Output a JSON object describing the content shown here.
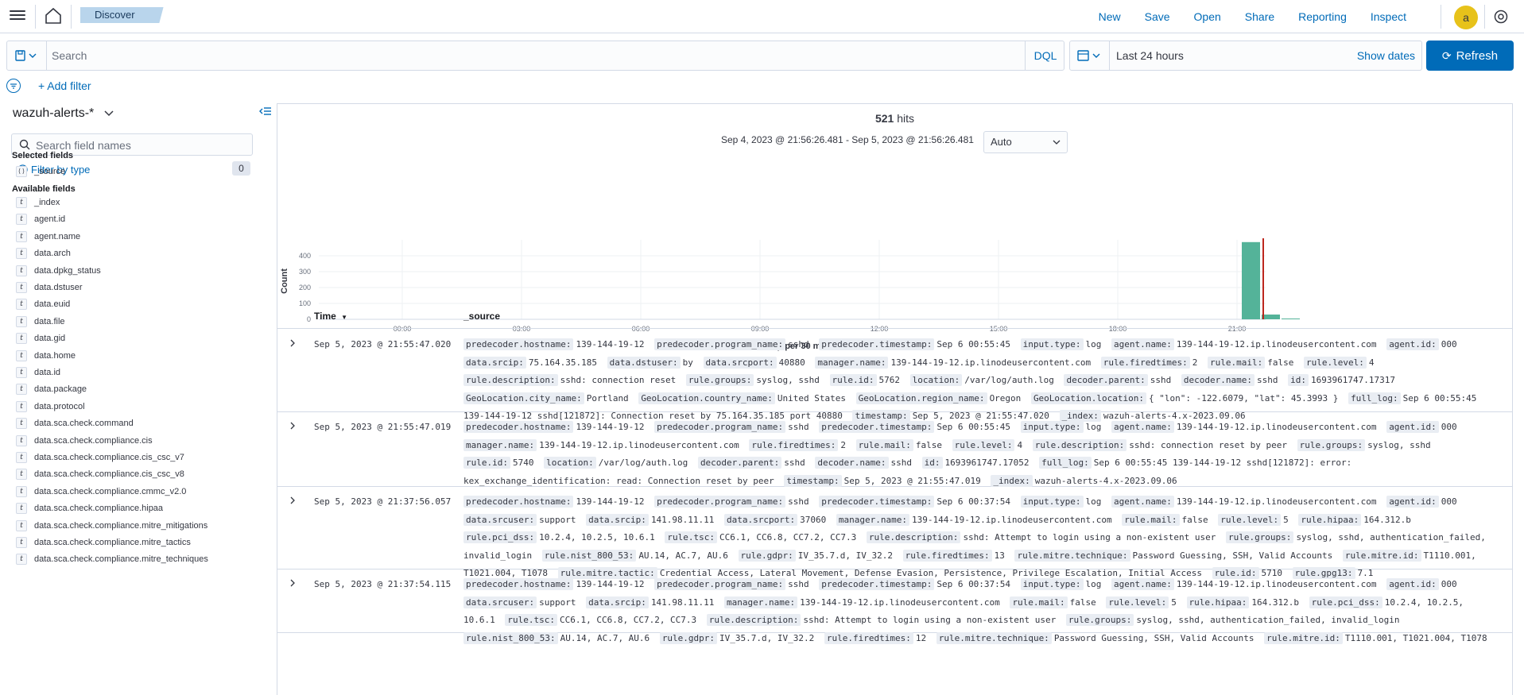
{
  "header": {
    "breadcrumb": "Discover",
    "links": [
      "New",
      "Save",
      "Open",
      "Share",
      "Reporting",
      "Inspect"
    ],
    "avatar_letter": "a"
  },
  "query": {
    "placeholder": "Search",
    "language": "DQL",
    "time_range": "Last 24 hours",
    "show_dates": "Show dates",
    "refresh": "Refresh",
    "add_filter": "+ Add filter"
  },
  "sidebar": {
    "index_pattern": "wazuh-alerts-*",
    "field_search_placeholder": "Search field names",
    "filter_by_type": "Filter by type",
    "filter_count": "0",
    "selected_title": "Selected fields",
    "selected": [
      "_source"
    ],
    "available_title": "Available fields",
    "available": [
      "_index",
      "agent.id",
      "agent.name",
      "data.arch",
      "data.dpkg_status",
      "data.dstuser",
      "data.euid",
      "data.file",
      "data.gid",
      "data.home",
      "data.id",
      "data.package",
      "data.protocol",
      "data.sca.check.command",
      "data.sca.check.compliance.cis",
      "data.sca.check.compliance.cis_csc_v7",
      "data.sca.check.compliance.cis_csc_v8",
      "data.sca.check.compliance.cmmc_v2.0",
      "data.sca.check.compliance.hipaa",
      "data.sca.check.compliance.mitre_mitigations",
      "data.sca.check.compliance.mitre_tactics",
      "data.sca.check.compliance.mitre_techniques"
    ]
  },
  "main": {
    "hits_count": "521",
    "hits_label": "hits",
    "range": "Sep 4, 2023 @ 21:56:26.481 - Sep 5, 2023 @ 21:56:26.481",
    "interval": "Auto",
    "time_col": "Time",
    "source_col": "_source"
  },
  "chart_data": {
    "type": "bar",
    "ylabel": "Count",
    "xlabel": "timestamp per 30 minutes",
    "x_ticks": [
      "00:00",
      "03:00",
      "06:00",
      "09:00",
      "12:00",
      "15:00",
      "18:00",
      "21:00"
    ],
    "y_ticks": [
      0,
      100,
      200,
      300,
      400
    ],
    "ylim": [
      0,
      500
    ],
    "bars": [
      {
        "time": "20:30",
        "value": 486
      },
      {
        "time": "21:00",
        "value": 30
      },
      {
        "time": "21:30",
        "value": 5
      }
    ],
    "color": "#54b399",
    "now_marker_color": "#bd271e"
  },
  "rows": [
    {
      "time": "Sep 5, 2023 @ 21:55:47.020",
      "fields": [
        [
          "predecoder.hostname:",
          "139-144-19-12"
        ],
        [
          "predecoder.program_name:",
          "sshd"
        ],
        [
          "predecoder.timestamp:",
          "Sep 6 00:55:45"
        ],
        [
          "input.type:",
          "log"
        ],
        [
          "agent.name:",
          "139-144-19-12.ip.linodeusercontent.com"
        ],
        [
          "agent.id:",
          "000"
        ],
        [
          "data.srcip:",
          "75.164.35.185"
        ],
        [
          "data.dstuser:",
          "by"
        ],
        [
          "data.srcport:",
          "40880"
        ],
        [
          "manager.name:",
          "139-144-19-12.ip.linodeusercontent.com"
        ],
        [
          "rule.firedtimes:",
          "2"
        ],
        [
          "rule.mail:",
          "false"
        ],
        [
          "rule.level:",
          "4"
        ],
        [
          "rule.description:",
          "sshd: connection reset"
        ],
        [
          "rule.groups:",
          "syslog, sshd"
        ],
        [
          "rule.id:",
          "5762"
        ],
        [
          "location:",
          "/var/log/auth.log"
        ],
        [
          "decoder.parent:",
          "sshd"
        ],
        [
          "decoder.name:",
          "sshd"
        ],
        [
          "id:",
          "1693961747.17317"
        ],
        [
          "GeoLocation.city_name:",
          "Portland"
        ],
        [
          "GeoLocation.country_name:",
          "United States"
        ],
        [
          "GeoLocation.region_name:",
          "Oregon"
        ],
        [
          "GeoLocation.location:",
          "{ \"lon\": -122.6079, \"lat\": 45.3993 }"
        ],
        [
          "full_log:",
          "Sep 6 00:55:45 139-144-19-12 sshd[121872]: Connection reset by 75.164.35.185 port 40880"
        ],
        [
          "timestamp:",
          "Sep 5, 2023 @ 21:55:47.020"
        ],
        [
          "_index:",
          "wazuh-alerts-4.x-2023.09.06"
        ]
      ]
    },
    {
      "time": "Sep 5, 2023 @ 21:55:47.019",
      "fields": [
        [
          "predecoder.hostname:",
          "139-144-19-12"
        ],
        [
          "predecoder.program_name:",
          "sshd"
        ],
        [
          "predecoder.timestamp:",
          "Sep 6 00:55:45"
        ],
        [
          "input.type:",
          "log"
        ],
        [
          "agent.name:",
          "139-144-19-12.ip.linodeusercontent.com"
        ],
        [
          "agent.id:",
          "000"
        ],
        [
          "manager.name:",
          "139-144-19-12.ip.linodeusercontent.com"
        ],
        [
          "rule.firedtimes:",
          "2"
        ],
        [
          "rule.mail:",
          "false"
        ],
        [
          "rule.level:",
          "4"
        ],
        [
          "rule.description:",
          "sshd: connection reset by peer"
        ],
        [
          "rule.groups:",
          "syslog, sshd"
        ],
        [
          "rule.id:",
          "5740"
        ],
        [
          "location:",
          "/var/log/auth.log"
        ],
        [
          "decoder.parent:",
          "sshd"
        ],
        [
          "decoder.name:",
          "sshd"
        ],
        [
          "id:",
          "1693961747.17052"
        ],
        [
          "full_log:",
          "Sep 6 00:55:45 139-144-19-12 sshd[121872]: error: kex_exchange_identification: read: Connection reset by peer"
        ],
        [
          "timestamp:",
          "Sep 5, 2023 @ 21:55:47.019"
        ],
        [
          "_index:",
          "wazuh-alerts-4.x-2023.09.06"
        ]
      ]
    },
    {
      "time": "Sep 5, 2023 @ 21:37:56.057",
      "fields": [
        [
          "predecoder.hostname:",
          "139-144-19-12"
        ],
        [
          "predecoder.program_name:",
          "sshd"
        ],
        [
          "predecoder.timestamp:",
          "Sep 6 00:37:54"
        ],
        [
          "input.type:",
          "log"
        ],
        [
          "agent.name:",
          "139-144-19-12.ip.linodeusercontent.com"
        ],
        [
          "agent.id:",
          "000"
        ],
        [
          "data.srcuser:",
          "support"
        ],
        [
          "data.srcip:",
          "141.98.11.11"
        ],
        [
          "data.srcport:",
          "37060"
        ],
        [
          "manager.name:",
          "139-144-19-12.ip.linodeusercontent.com"
        ],
        [
          "rule.mail:",
          "false"
        ],
        [
          "rule.level:",
          "5"
        ],
        [
          "rule.hipaa:",
          "164.312.b"
        ],
        [
          "rule.pci_dss:",
          "10.2.4, 10.2.5, 10.6.1"
        ],
        [
          "rule.tsc:",
          "CC6.1, CC6.8, CC7.2, CC7.3"
        ],
        [
          "rule.description:",
          "sshd: Attempt to login using a non-existent user"
        ],
        [
          "rule.groups:",
          "syslog, sshd, authentication_failed, invalid_login"
        ],
        [
          "rule.nist_800_53:",
          "AU.14, AC.7, AU.6"
        ],
        [
          "rule.gdpr:",
          "IV_35.7.d, IV_32.2"
        ],
        [
          "rule.firedtimes:",
          "13"
        ],
        [
          "rule.mitre.technique:",
          "Password Guessing, SSH, Valid Accounts"
        ],
        [
          "rule.mitre.id:",
          "T1110.001, T1021.004, T1078"
        ],
        [
          "rule.mitre.tactic:",
          "Credential Access, Lateral Movement, Defense Evasion, Persistence, Privilege Escalation, Initial Access"
        ],
        [
          "rule.id:",
          "5710"
        ],
        [
          "rule.gpg13:",
          "7.1"
        ]
      ]
    },
    {
      "time": "Sep 5, 2023 @ 21:37:54.115",
      "fields": [
        [
          "predecoder.hostname:",
          "139-144-19-12"
        ],
        [
          "predecoder.program_name:",
          "sshd"
        ],
        [
          "predecoder.timestamp:",
          "Sep 6 00:37:54"
        ],
        [
          "input.type:",
          "log"
        ],
        [
          "agent.name:",
          "139-144-19-12.ip.linodeusercontent.com"
        ],
        [
          "agent.id:",
          "000"
        ],
        [
          "data.srcuser:",
          "support"
        ],
        [
          "data.srcip:",
          "141.98.11.11"
        ],
        [
          "manager.name:",
          "139-144-19-12.ip.linodeusercontent.com"
        ],
        [
          "rule.mail:",
          "false"
        ],
        [
          "rule.level:",
          "5"
        ],
        [
          "rule.hipaa:",
          "164.312.b"
        ],
        [
          "rule.pci_dss:",
          "10.2.4, 10.2.5, 10.6.1"
        ],
        [
          "rule.tsc:",
          "CC6.1, CC6.8, CC7.2, CC7.3"
        ],
        [
          "rule.description:",
          "sshd: Attempt to login using a non-existent user"
        ],
        [
          "rule.groups:",
          "syslog, sshd, authentication_failed, invalid_login"
        ],
        [
          "rule.nist_800_53:",
          "AU.14, AC.7, AU.6"
        ],
        [
          "rule.gdpr:",
          "IV_35.7.d, IV_32.2"
        ],
        [
          "rule.firedtimes:",
          "12"
        ],
        [
          "rule.mitre.technique:",
          "Password Guessing, SSH, Valid Accounts"
        ],
        [
          "rule.mitre.id:",
          "T1110.001, T1021.004, T1078"
        ]
      ]
    }
  ]
}
